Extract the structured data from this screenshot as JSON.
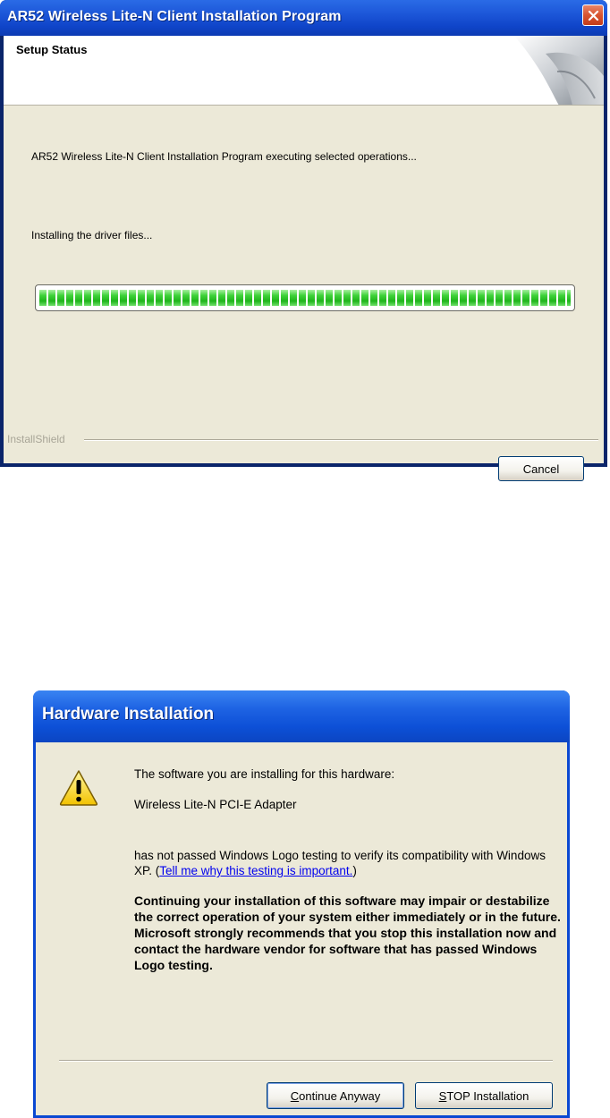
{
  "installer_window": {
    "title": "AR52 Wireless Lite-N Client Installation Program",
    "header_title": "Setup Status",
    "status_text": "AR52 Wireless Lite-N Client Installation Program executing selected operations...",
    "action_text": "Installing the driver files...",
    "progress_fraction": 1.0,
    "brand_label": "InstallShield",
    "cancel_label": "Cancel",
    "close_icon": "close-icon"
  },
  "hardware_dialog": {
    "title": "Hardware Installation",
    "icon": "warning-icon",
    "intro": "The software you are installing for this hardware:",
    "device_name": "Wireless Lite-N PCI-E Adapter",
    "logo_text_1": "has not passed Windows Logo testing to verify its compatibility with Windows XP. (",
    "logo_link": "Tell me why this testing is important.",
    "logo_text_2": ")",
    "warning_bold": "Continuing your installation of this software may impair or destabilize the correct operation of your system either immediately or in the future. Microsoft strongly recommends that you stop this installation now and contact the hardware vendor for software that has passed Windows Logo testing.",
    "continue_label_mnemonic": "C",
    "continue_label_rest": "ontinue Anyway",
    "stop_label_mnemonic": "S",
    "stop_label_rest": "TOP Installation"
  },
  "colors": {
    "titlebar_blue": "#0c3bb3",
    "dialog_face": "#ece9d8",
    "progress_green": "#1fb51b",
    "close_red": "#d8542f"
  }
}
